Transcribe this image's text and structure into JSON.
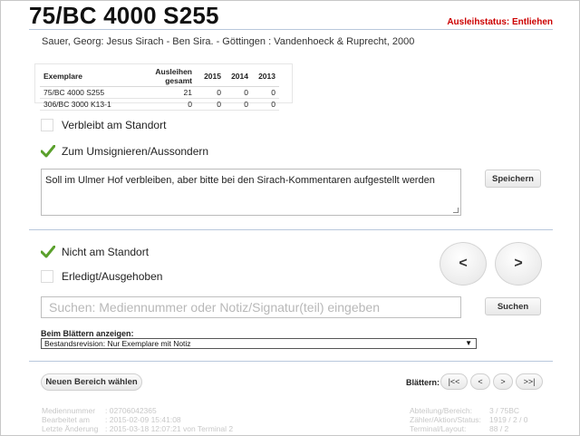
{
  "header": {
    "title": "75/BC 4000 S255",
    "status": "Ausleihstatus: Entliehen"
  },
  "bibliography": "Sauer, Georg: Jesus Sirach - Ben Sira. - Göttingen : Vandenhoeck & Ruprecht, 2000",
  "copies_table": {
    "headers": [
      "Exemplare",
      "Ausleihen gesamt",
      "2015",
      "2014",
      "2013"
    ],
    "rows": [
      [
        "75/BC 4000 S255",
        "21",
        "0",
        "0",
        "0"
      ],
      [
        "306/BC 3000 K13-1",
        "0",
        "0",
        "0",
        "0"
      ]
    ]
  },
  "options": {
    "verbleibt": {
      "label": "Verbleibt am Standort",
      "checked": false
    },
    "umsignieren": {
      "label": "Zum Umsignieren/Aussondern",
      "checked": true
    },
    "nicht_am_standort": {
      "label": "Nicht am Standort",
      "checked": true
    },
    "erledigt": {
      "label": "Erledigt/Ausgehoben",
      "checked": false
    }
  },
  "note": {
    "value": "Soll im Ulmer Hof verbleiben, aber bitte bei den Sirach-Kommentaren aufgestellt werden",
    "save_label": "Speichern"
  },
  "arrows": {
    "prev": "<",
    "next": ">"
  },
  "search": {
    "placeholder": "Suchen: Mediennummer oder Notiz/Signatur(teil) eingeben",
    "button_label": "Suchen"
  },
  "browse": {
    "label": "Beim Blättern anzeigen:",
    "selected": "Bestandsrevision: Nur Exemplare mit Notiz"
  },
  "footer": {
    "new_area_label": "Neuen Bereich wählen",
    "blattern_label": "Blättern:",
    "nav": {
      "first": "|<<",
      "prev": "<",
      "next": ">",
      "last": ">>|"
    },
    "info_left": [
      {
        "key": "Mediennummer",
        "value": ": 02706042365"
      },
      {
        "key": "Bearbeitet am",
        "value": ": 2015-02-09 15:41:08"
      },
      {
        "key": "Letzte Änderung",
        "value": ": 2015-03-18 12:07:21 von Terminal 2"
      }
    ],
    "info_right": [
      {
        "key": "Abteilung/Bereich:",
        "value": "3 / 75BC"
      },
      {
        "key": "Zähler/Aktion/Status:",
        "value": "1919 / 2 / 0"
      },
      {
        "key": "Terminal/Layout:",
        "value": "88 / 2"
      }
    ]
  },
  "colors": {
    "status": "#cc0000",
    "check": "#5aa02c",
    "rule": "#b9c8dc"
  }
}
